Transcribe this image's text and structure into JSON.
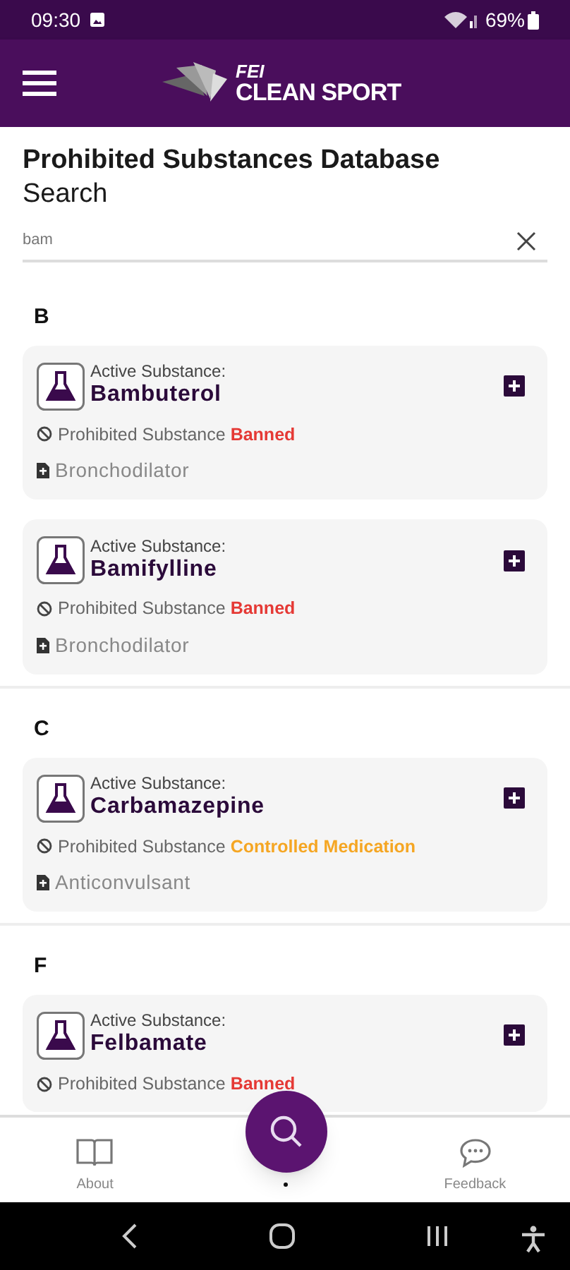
{
  "status_bar": {
    "time": "09:30",
    "battery": "69%"
  },
  "app_bar": {
    "logo_top": "FEI",
    "logo_bottom": "CLEAN SPORT"
  },
  "heading": {
    "title": "Prohibited Substances Database",
    "subtitle": "Search"
  },
  "search": {
    "value": "bam"
  },
  "sections": [
    {
      "letter": "B",
      "items": [
        {
          "label": "Active Substance:",
          "name": "Bambuterol",
          "status_label": "Prohibited Substance",
          "status": "Banned",
          "color": "#e53935",
          "category": "Bronchodilator"
        },
        {
          "label": "Active Substance:",
          "name": "Bamifylline",
          "status_label": "Prohibited Substance",
          "status": "Banned",
          "color": "#e53935",
          "category": "Bronchodilator"
        }
      ]
    },
    {
      "letter": "C",
      "items": [
        {
          "label": "Active Substance:",
          "name": "Carbamazepine",
          "status_label": "Prohibited Substance",
          "status": "Controlled Medication",
          "color": "#f5a623",
          "category": "Anticonvulsant"
        }
      ]
    },
    {
      "letter": "F",
      "items": [
        {
          "label": "Active Substance:",
          "name": "Felbamate",
          "status_label": "Prohibited Substance",
          "status": "Banned",
          "color": "#e53935"
        }
      ]
    }
  ],
  "bottom_nav": [
    {
      "label": "About",
      "kind": "book"
    },
    {
      "kind": "search",
      "selected": true
    },
    {
      "label": "Feedback",
      "kind": "chat"
    }
  ]
}
